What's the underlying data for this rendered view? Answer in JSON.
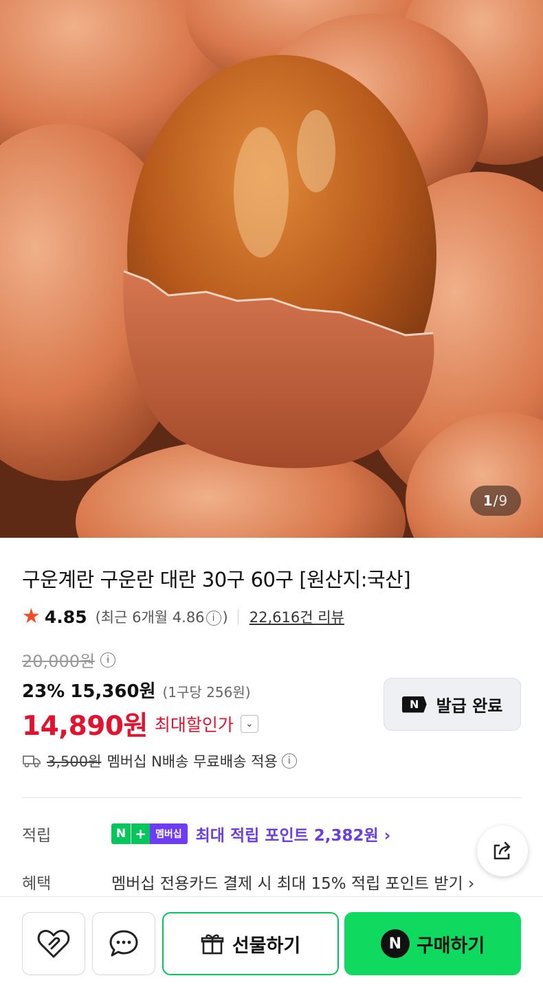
{
  "gallery": {
    "current": "1",
    "separator": "/",
    "total": "9"
  },
  "product": {
    "title": "구운계란 구운란 대란 30구 60구 [원산지:국산]"
  },
  "rating": {
    "value": "4.85",
    "recent_prefix": "(최근 6개월 4.86",
    "recent_suffix": ")",
    "reviews": "22,616건 리뷰"
  },
  "price": {
    "original": "20,000원",
    "discount": "23%",
    "sale": "15,360원",
    "unit": "(1구당 256원)",
    "max": "14,890원",
    "max_label": "최대할인가"
  },
  "coupon": {
    "label": "발급 완료",
    "badge": "N"
  },
  "shipping": {
    "fee": "3,500원",
    "text": "멤버십 N배송 무료배송 적용"
  },
  "benefits": {
    "points_label": "적립",
    "membership_badge": "멤버십",
    "points_text": "최대 적립 포인트 2,382원 ›",
    "benefit_label": "혜택",
    "benefit_text": "멤버십 전용카드 결제 시 최대 15% 적립 포인트 받기 ›"
  },
  "bottom_bar": {
    "gift": "선물하기",
    "buy": "구매하기",
    "buy_badge": "N"
  },
  "colors": {
    "accent_green": "#03c75a",
    "price_red": "#e4122e",
    "points_purple": "#6c3ce5"
  },
  "icons": [
    "star-icon",
    "info-icon",
    "chevron-down-icon",
    "truck-icon",
    "share-icon",
    "heart-icon",
    "chat-icon",
    "gift-icon"
  ]
}
